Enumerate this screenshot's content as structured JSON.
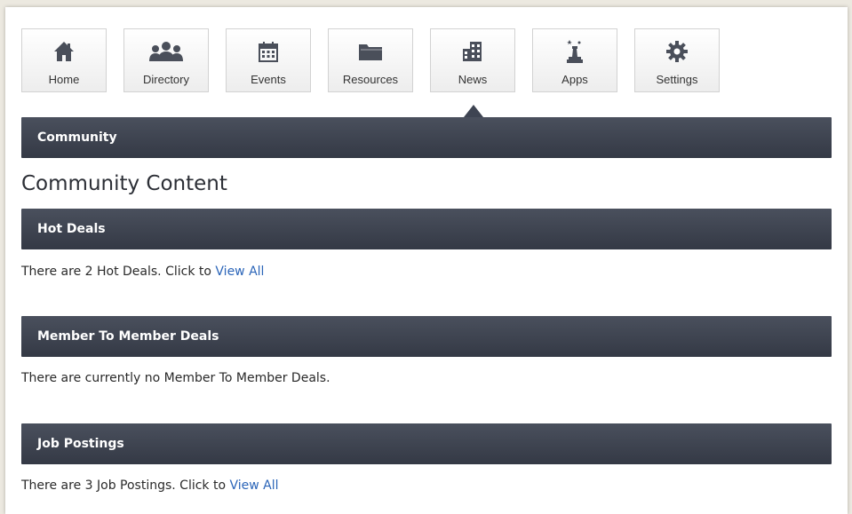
{
  "nav": {
    "items": [
      {
        "label": "Home",
        "icon": "home-icon"
      },
      {
        "label": "Directory",
        "icon": "people-icon"
      },
      {
        "label": "Events",
        "icon": "calendar-icon"
      },
      {
        "label": "Resources",
        "icon": "folder-icon"
      },
      {
        "label": "News",
        "icon": "building-icon"
      },
      {
        "label": "Apps",
        "icon": "chess-piece-icon"
      },
      {
        "label": "Settings",
        "icon": "gear-icon"
      }
    ],
    "active": "News"
  },
  "community": {
    "bar_title": "Community",
    "heading": "Community Content"
  },
  "sections": {
    "hot_deals": {
      "title": "Hot Deals",
      "text": "There are 2 Hot Deals. Click to ",
      "link": "View All"
    },
    "member_deals": {
      "title": "Member To Member Deals",
      "text": "There are currently no Member To Member Deals."
    },
    "job_postings": {
      "title": "Job Postings",
      "text": "There are 3 Job Postings. Click to ",
      "link": "View All"
    }
  },
  "colors": {
    "bar": "#3e4452",
    "link": "#2a64b8",
    "icon": "#4a4f5a"
  }
}
